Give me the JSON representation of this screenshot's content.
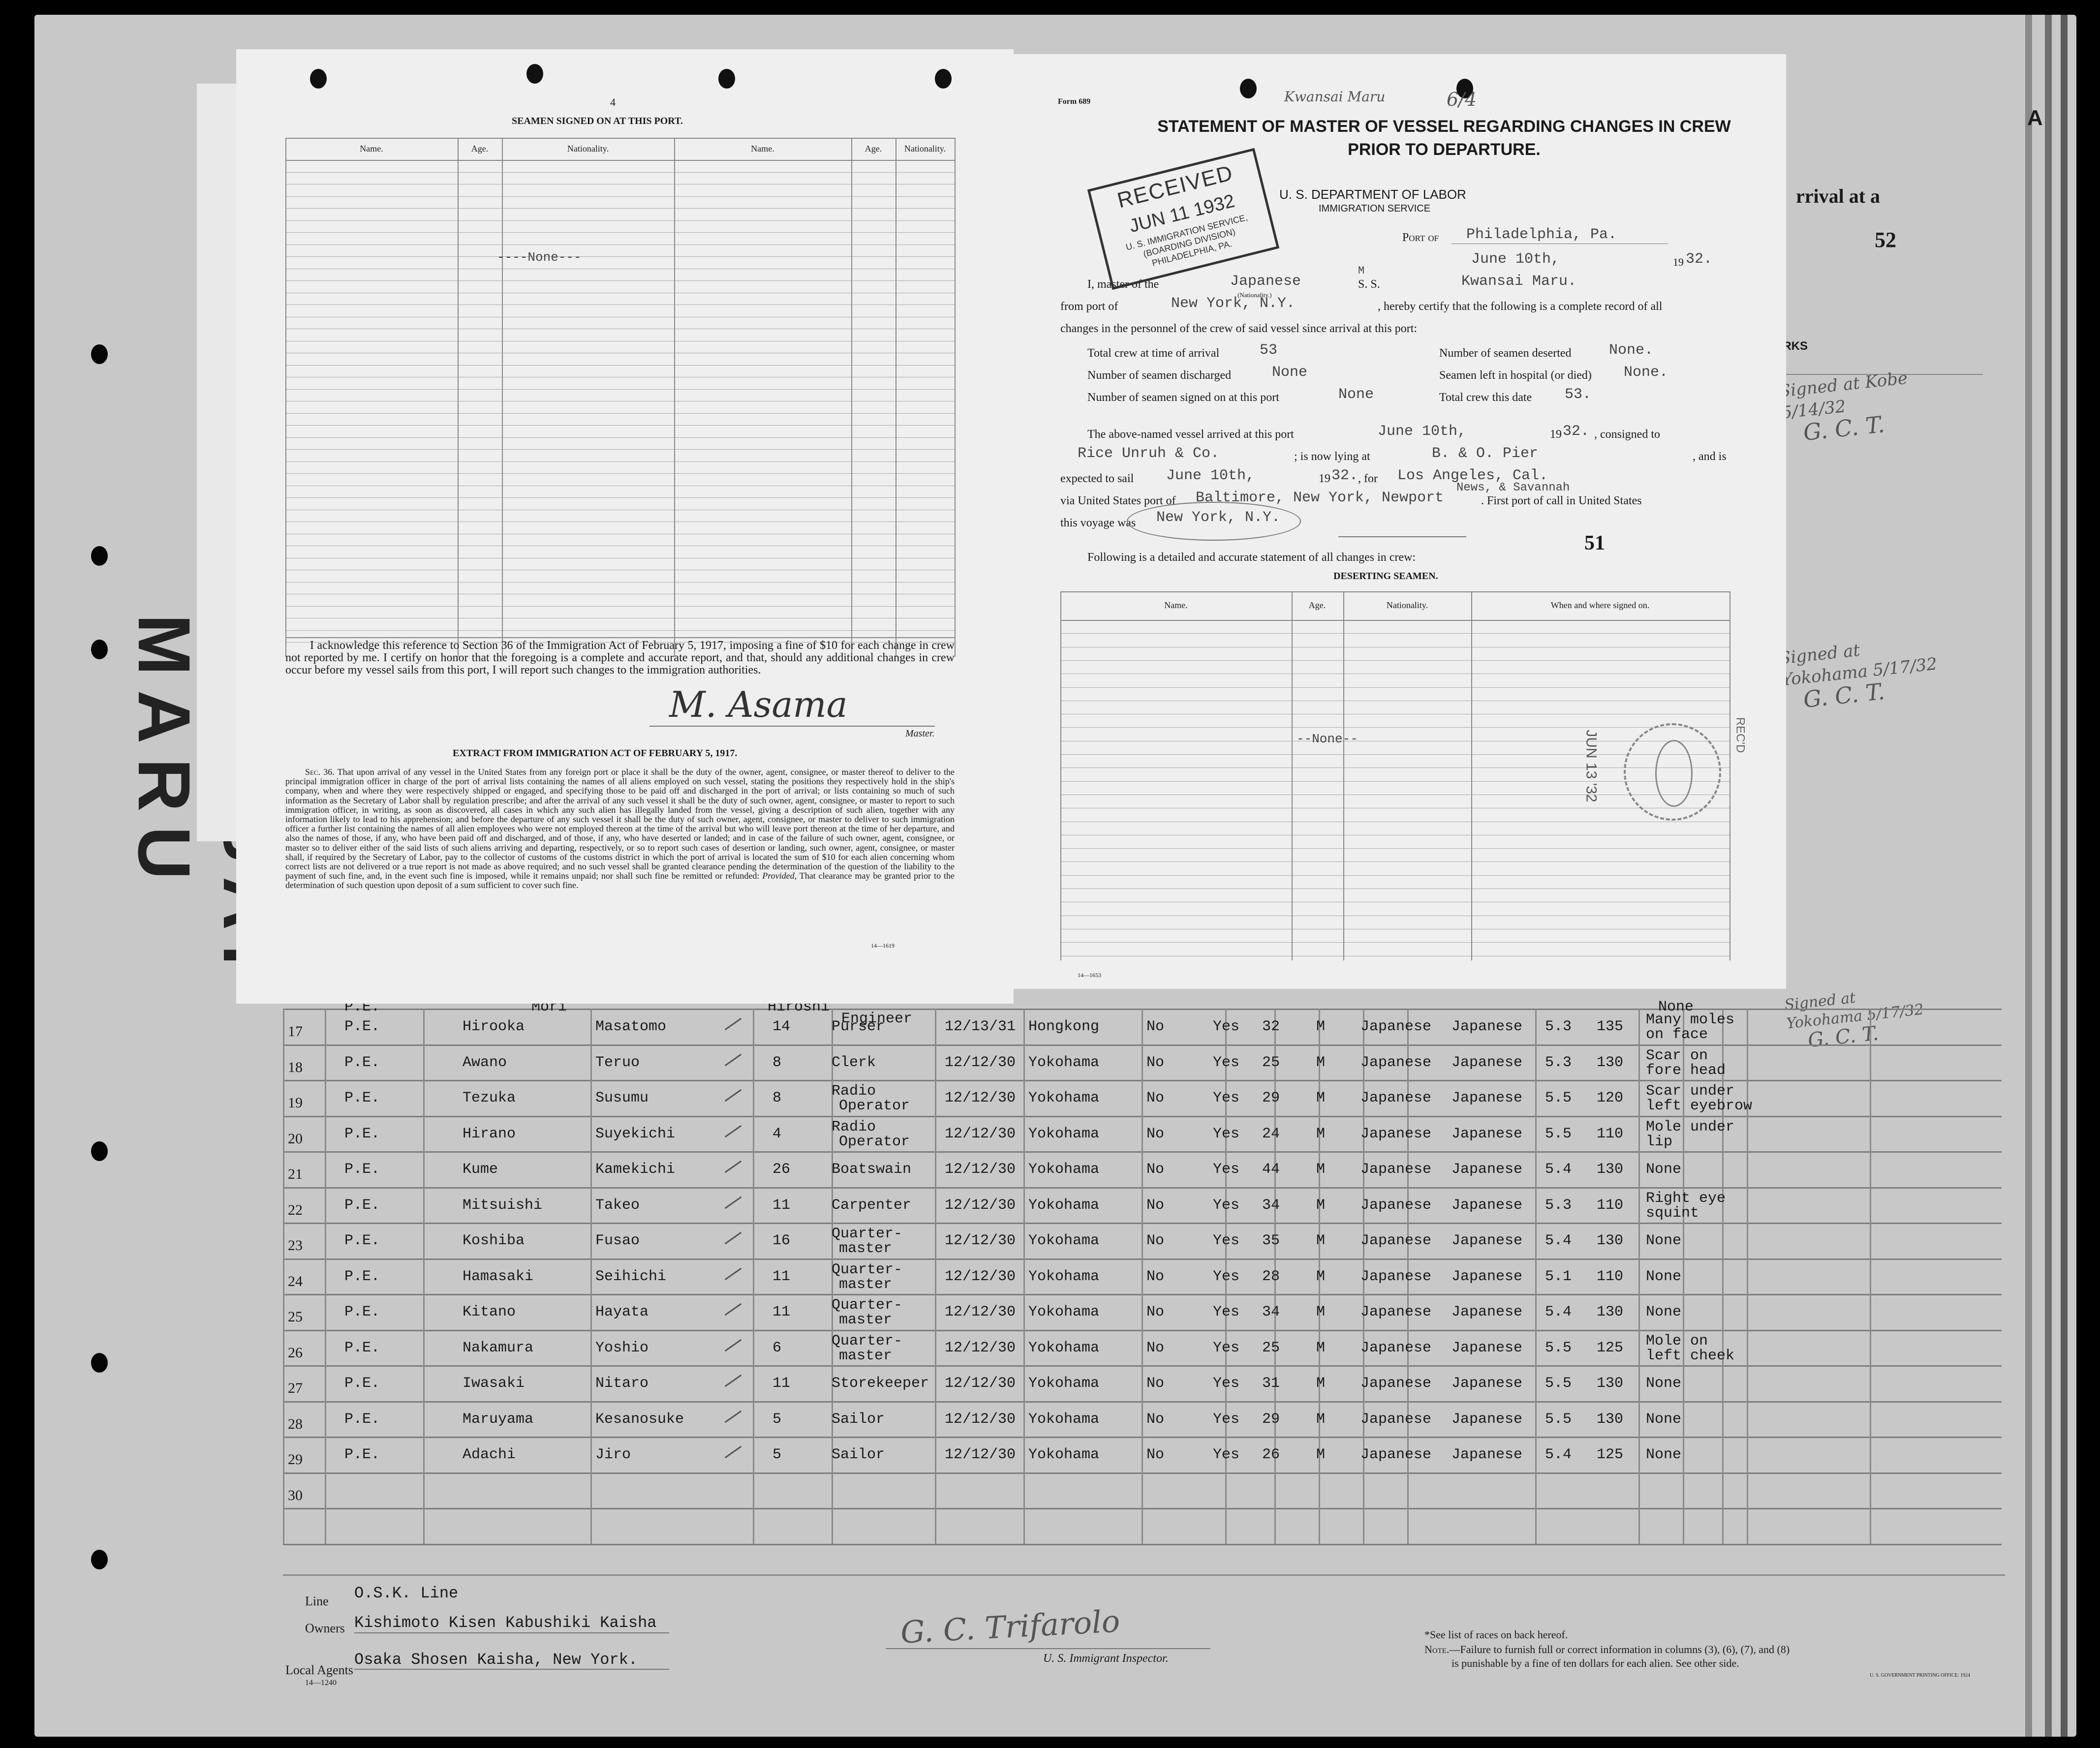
{
  "left_form": {
    "page_number": "4",
    "title": "SEAMEN SIGNED ON AT THIS PORT.",
    "columns": [
      "Name.",
      "Age.",
      "Nationality.",
      "Name.",
      "Age.",
      "Nationality."
    ],
    "none_entry": "----None---",
    "acknowledgement": "I acknowledge this reference to Section 36 of the Immigration Act of February 5, 1917, imposing a fine of $10 for each change in crew not reported by me. I certify on honor that the foregoing is a complete and accurate report, and that, should any additional changes in crew occur before my vessel sails from this port, I will report such changes to the immigration authorities.",
    "signature": "M. Asama",
    "signature_caption": "Master.",
    "extract_title": "EXTRACT FROM IMMIGRATION ACT OF FEBRUARY 5, 1917.",
    "extract_lead": "Sec. 36.",
    "extract_body": "That upon arrival of any vessel in the United States from any foreign port or place it shall be the duty of the owner, agent, consignee, or master thereof to deliver to the principal immigration officer in charge of the port of arrival lists containing the names of all aliens employed on such vessel, stating the positions they respectively hold in the ship's company, when and where they were respectively shipped or engaged, and specifying those to be paid off and discharged in the port of arrival; or lists containing so much of such information as the Secretary of Labor shall by regulation prescribe; and after the arrival of any such vessel it shall be the duty of such owner, agent, consignee, or master to report to such immigration officer, in writing, as soon as discovered, all cases in which any such alien has illegally landed from the vessel, giving a description of such alien, together with any information likely to lead to his apprehension; and before the departure of any such vessel it shall be the duty of such owner, agent, consignee, or master to deliver to such immigration officer a further list containing the names of all alien employees who were not employed thereon at the time of the arrival but who will leave port thereon at the time of her departure, and also the names of those, if any, who have been paid off and discharged, and of those, if any, who have deserted or landed; and in case of the failure of such owner, agent, consignee, or master so to deliver either of the said lists of such aliens arriving and departing, respectively, or so to report such cases of desertion or landing, such owner, agent, consignee, or master shall, if required by the Secretary of Labor, pay to the collector of customs of the customs district in which the port of arrival is located the sum of $10 for each alien concerning whom correct lists are not delivered or a true report is not made as above required; and no such vessel shall be granted clearance pending the determination of the question of the liability to the payment of such fine, and, in the event such fine is imposed, while it remains unpaid; nor shall such fine be remitted or refunded:",
    "extract_proviso_word": "Provided,",
    "extract_proviso": "That clearance may be granted prior to the determination of such question upon deposit of a sum sufficient to cover such fine.",
    "form_code": "14—1619"
  },
  "right_form": {
    "form_number": "Form 689",
    "title_line1": "STATEMENT OF MASTER OF VESSEL REGARDING CHANGES IN CREW",
    "title_line2": "PRIOR TO DEPARTURE.",
    "dept": "U. S. DEPARTMENT OF LABOR",
    "service": "IMMIGRATION SERVICE",
    "port_label": "Port of",
    "port_value": "Philadelphia, Pa.",
    "date_value": "June 10th,",
    "year_prefix": "19",
    "year_value": "32.",
    "master_label": "I, master of the",
    "nationality_value": "Japanese",
    "nationality_caption": "(Nationality.)",
    "ship_type_mark": "M",
    "ss_label": "S. S.",
    "ship_name": "Kwansai Maru.",
    "from_port_label": "from port of",
    "from_port_value": "New York, N.Y.",
    "certify_text": ", hereby certify that the following is a complete record of all",
    "certify_text2": "changes in the personnel of the crew of said vessel since arrival at this port:",
    "total_crew_arrival_label": "Total crew at time of arrival",
    "total_crew_arrival_value": "53",
    "deserted_label": "Number of seamen deserted",
    "deserted_value": "None.",
    "discharged_label": "Number of seamen discharged",
    "discharged_value": "None",
    "hospital_label": "Seamen left in hospital (or died)",
    "hospital_value": "None.",
    "signed_on_label": "Number of seamen signed on at this port",
    "signed_on_value": "None",
    "total_crew_date_label": "Total crew this date",
    "total_crew_date_value": "53.",
    "arrived_label": "The above-named vessel arrived at this port",
    "arrived_value": "June 10th,",
    "consigned_label": ", consigned to",
    "consignee_value": "Rice Unruh & Co.",
    "lying_label": "; is now lying at",
    "lying_value": "B. & O. Pier",
    "and_is": ", and is",
    "expected_label": "expected to sail",
    "expected_value": "June 10th,",
    "for_label": ", for",
    "for_value": "Los Angeles, Cal.",
    "via_label": "via United States port of",
    "via_value": "Baltimore, New York, Newport",
    "via_value2": "News, & Savannah",
    "first_port_label": ". First port of call in United States",
    "voyage_label": "this voyage was",
    "voyage_value": "New York, N.Y.",
    "page_number": "51",
    "following_text": "Following is a detailed and accurate statement of all changes in crew:",
    "deserting_title": "DESERTING SEAMEN.",
    "columns": [
      "Name.",
      "Age.",
      "Nationality.",
      "When and where signed on."
    ],
    "none_entry": "--None--",
    "form_code": "14—1653"
  },
  "stamp_received": {
    "line1": "RECEIVED",
    "line2": "JUN 11 1932",
    "line3": "U. S. IMMIGRATION SERVICE,",
    "line4": "(BOARDING DIVISION)",
    "line5": "PHILADELPHIA, PA."
  },
  "stamp_round": {
    "date": "JUN 13 '32",
    "side": "REC'D"
  },
  "top_note": "Kwansai Maru",
  "top_number": "6/4",
  "sheet_header": {
    "letter": "A",
    "arrival": "rrival at a",
    "list_number": "52",
    "remarks": "EMARKS"
  },
  "margin_vertical_text": "KWANSAI MARU",
  "margin_annotations": [
    {
      "line1": "Signed at Kobe",
      "line2": "5/14/32",
      "line3": "G. C. T."
    },
    {
      "line1": "Signed at",
      "line2": "Yokohama 5/17/32",
      "line3": "G. C. T."
    },
    {
      "line1": "Signed at",
      "line2": "Yokohama 5/17/32",
      "line3": "G. C. T."
    }
  ],
  "crew_rows": [
    {
      "num": "17",
      "code": "P.E.",
      "surname": "Hirooka",
      "given": "Masatomo",
      "years": "14",
      "position": "Purser",
      "date": "12/13/31",
      "place": "Hongkong",
      "c1": "No",
      "c2": "Yes",
      "age": "32",
      "sex": "M",
      "nat": "Japanese",
      "race": "Japanese",
      "height": "5.3",
      "weight": "135",
      "marks": "Many moles",
      "marks2": "on face"
    },
    {
      "num": "18",
      "code": "P.E.",
      "surname": "Awano",
      "given": "Teruo",
      "years": "8",
      "position": "Clerk",
      "date": "12/12/30",
      "place": "Yokohama",
      "c1": "No",
      "c2": "Yes",
      "age": "25",
      "sex": "M",
      "nat": "Japanese",
      "race": "Japanese",
      "height": "5.3",
      "weight": "130",
      "marks": "Scar on",
      "marks2": "fore head"
    },
    {
      "num": "19",
      "code": "P.E.",
      "surname": "Tezuka",
      "given": "Susumu",
      "years": "8",
      "position": "Radio",
      "position2": "Operator",
      "date": "12/12/30",
      "place": "Yokohama",
      "c1": "No",
      "c2": "Yes",
      "age": "29",
      "sex": "M",
      "nat": "Japanese",
      "race": "Japanese",
      "height": "5.5",
      "weight": "120",
      "marks": "Scar under",
      "marks2": "left eyebrow"
    },
    {
      "num": "20",
      "code": "P.E.",
      "surname": "Hirano",
      "given": "Suyekichi",
      "years": "4",
      "position": "Radio",
      "position2": "Operator",
      "date": "12/12/30",
      "place": "Yokohama",
      "c1": "No",
      "c2": "Yes",
      "age": "24",
      "sex": "M",
      "nat": "Japanese",
      "race": "Japanese",
      "height": "5.5",
      "weight": "110",
      "marks": "Mole under",
      "marks2": "lip"
    },
    {
      "num": "21",
      "code": "P.E.",
      "surname": "Kume",
      "given": "Kamekichi",
      "years": "26",
      "position": "Boatswain",
      "date": "12/12/30",
      "place": "Yokohama",
      "c1": "No",
      "c2": "Yes",
      "age": "44",
      "sex": "M",
      "nat": "Japanese",
      "race": "Japanese",
      "height": "5.4",
      "weight": "130",
      "marks": "None",
      "marks2": ""
    },
    {
      "num": "22",
      "code": "P.E.",
      "surname": "Mitsuishi",
      "given": "Takeo",
      "years": "11",
      "position": "Carpenter",
      "date": "12/12/30",
      "place": "Yokohama",
      "c1": "No",
      "c2": "Yes",
      "age": "34",
      "sex": "M",
      "nat": "Japanese",
      "race": "Japanese",
      "height": "5.3",
      "weight": "110",
      "marks": "Right eye",
      "marks2": "squint"
    },
    {
      "num": "23",
      "code": "P.E.",
      "surname": "Koshiba",
      "given": "Fusao",
      "years": "16",
      "position": "Quarter-",
      "position2": "master",
      "date": "12/12/30",
      "place": "Yokohama",
      "c1": "No",
      "c2": "Yes",
      "age": "35",
      "sex": "M",
      "nat": "Japanese",
      "race": "Japanese",
      "height": "5.4",
      "weight": "130",
      "marks": "None",
      "marks2": ""
    },
    {
      "num": "24",
      "code": "P.E.",
      "surname": "Hamasaki",
      "given": "Seihichi",
      "years": "11",
      "position": "Quarter-",
      "position2": "master",
      "date": "12/12/30",
      "place": "Yokohama",
      "c1": "No",
      "c2": "Yes",
      "age": "28",
      "sex": "M",
      "nat": "Japanese",
      "race": "Japanese",
      "height": "5.1",
      "weight": "110",
      "marks": "None",
      "marks2": ""
    },
    {
      "num": "25",
      "code": "P.E.",
      "surname": "Kitano",
      "given": "Hayata",
      "years": "11",
      "position": "Quarter-",
      "position2": "master",
      "date": "12/12/30",
      "place": "Yokohama",
      "c1": "No",
      "c2": "Yes",
      "age": "34",
      "sex": "M",
      "nat": "Japanese",
      "race": "Japanese",
      "height": "5.4",
      "weight": "130",
      "marks": "None",
      "marks2": ""
    },
    {
      "num": "26",
      "code": "P.E.",
      "surname": "Nakamura",
      "given": "Yoshio",
      "years": "6",
      "position": "Quarter-",
      "position2": "master",
      "date": "12/12/30",
      "place": "Yokohama",
      "c1": "No",
      "c2": "Yes",
      "age": "25",
      "sex": "M",
      "nat": "Japanese",
      "race": "Japanese",
      "height": "5.5",
      "weight": "125",
      "marks": "Mole on",
      "marks2": "left cheek"
    },
    {
      "num": "27",
      "code": "P.E.",
      "surname": "Iwasaki",
      "given": "Nitaro",
      "years": "11",
      "position": "Storekeeper",
      "date": "12/12/30",
      "place": "Yokohama",
      "c1": "No",
      "c2": "Yes",
      "age": "31",
      "sex": "M",
      "nat": "Japanese",
      "race": "Japanese",
      "height": "5.5",
      "weight": "130",
      "marks": "None",
      "marks2": ""
    },
    {
      "num": "28",
      "code": "P.E.",
      "surname": "Maruyama",
      "given": "Kesanosuke",
      "years": "5",
      "position": "Sailor",
      "date": "12/12/30",
      "place": "Yokohama",
      "c1": "No",
      "c2": "Yes",
      "age": "29",
      "sex": "M",
      "nat": "Japanese",
      "race": "Japanese",
      "height": "5.5",
      "weight": "130",
      "marks": "None",
      "marks2": ""
    },
    {
      "num": "29",
      "code": "P.E.",
      "surname": "Adachi",
      "given": "Jiro",
      "years": "5",
      "position": "Sailor",
      "date": "12/12/30",
      "place": "Yokohama",
      "c1": "No",
      "c2": "Yes",
      "age": "26",
      "sex": "M",
      "nat": "Japanese",
      "race": "Japanese",
      "height": "5.4",
      "weight": "125",
      "marks": "None",
      "marks2": ""
    },
    {
      "num": "30"
    }
  ],
  "partial_row": {
    "code": "P.E.",
    "surname": "Mori",
    "given": "Hiroshi",
    "position": "Engineer",
    "marks": "None"
  },
  "footer": {
    "line_label": "Line",
    "line_value": "O.S.K. Line",
    "owners_label": "Owners",
    "owners_value": "Kishimoto Kisen Kabushiki Kaisha",
    "agents_label": "Local Agents",
    "agents_value": "Osaka Shosen Kaisha, New York.",
    "agents_code": "14—1240",
    "inspector_signature": "G. C. Trifarolo",
    "inspector_caption": "U. S. Immigrant Inspector.",
    "note1": "*See list of races on back hereof.",
    "note2_label": "Note.",
    "note2": "—Failure to furnish full or correct information in columns (3), (6), (7), and (8)",
    "note3": "is punishable by a fine of ten dollars for each alien.  See other side.",
    "printer": "U. S. GOVERNMENT PRINTING OFFICE: 1924"
  }
}
